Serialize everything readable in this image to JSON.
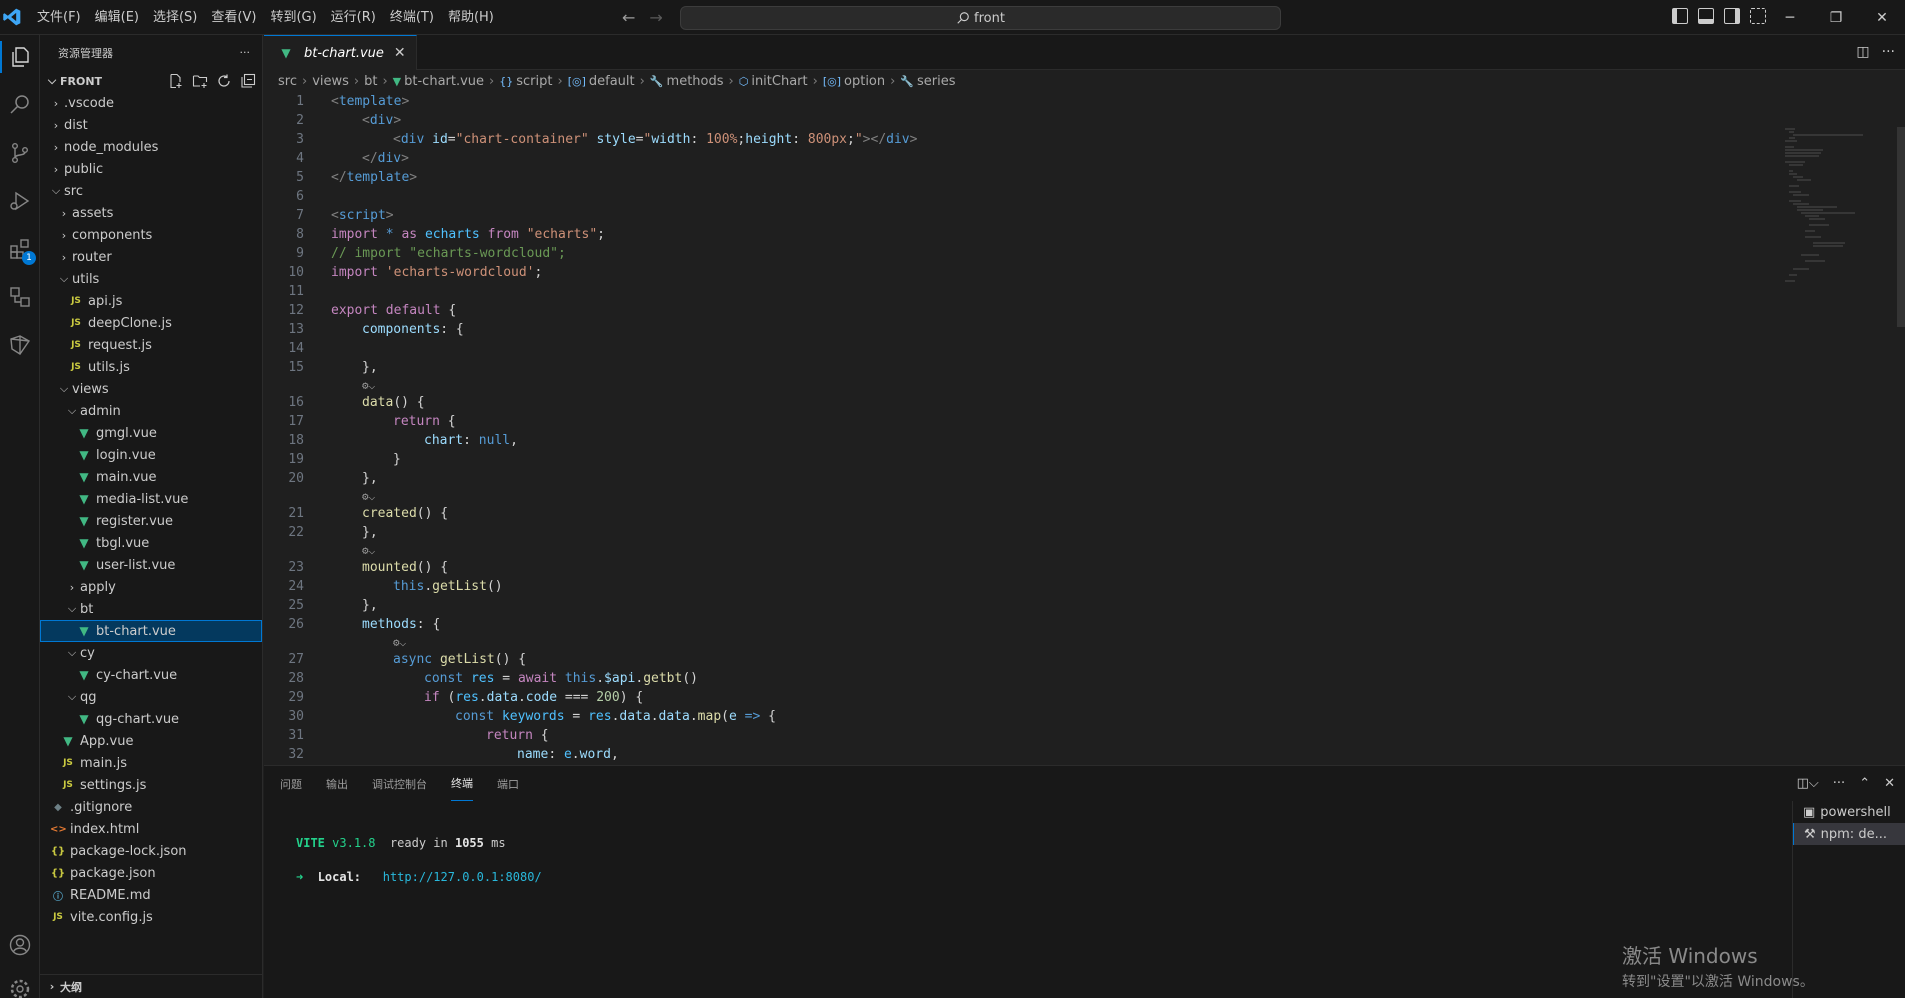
{
  "titlebar": {
    "menu": [
      "文件(F)",
      "编辑(E)",
      "选择(S)",
      "查看(V)",
      "转到(G)",
      "运行(R)",
      "终端(T)",
      "帮助(H)"
    ],
    "search_text": "front",
    "window_controls": [
      "─",
      "❐",
      "✕"
    ]
  },
  "activity": {
    "extensions_badge": "1"
  },
  "sidebar": {
    "title": "资源管理器",
    "more": "···",
    "folder": "FRONT",
    "tree": [
      {
        "label": ".vscode",
        "depth": 0,
        "type": "folder",
        "open": false
      },
      {
        "label": "dist",
        "depth": 0,
        "type": "folder",
        "open": false
      },
      {
        "label": "node_modules",
        "depth": 0,
        "type": "folder",
        "open": false
      },
      {
        "label": "public",
        "depth": 0,
        "type": "folder",
        "open": false
      },
      {
        "label": "src",
        "depth": 0,
        "type": "folder",
        "open": true
      },
      {
        "label": "assets",
        "depth": 1,
        "type": "folder",
        "open": false
      },
      {
        "label": "components",
        "depth": 1,
        "type": "folder",
        "open": false
      },
      {
        "label": "router",
        "depth": 1,
        "type": "folder",
        "open": false
      },
      {
        "label": "utils",
        "depth": 1,
        "type": "folder",
        "open": true
      },
      {
        "label": "api.js",
        "depth": 2,
        "type": "js"
      },
      {
        "label": "deepClone.js",
        "depth": 2,
        "type": "js"
      },
      {
        "label": "request.js",
        "depth": 2,
        "type": "js"
      },
      {
        "label": "utils.js",
        "depth": 2,
        "type": "js"
      },
      {
        "label": "views",
        "depth": 1,
        "type": "folder",
        "open": true
      },
      {
        "label": "admin",
        "depth": 2,
        "type": "folder",
        "open": true
      },
      {
        "label": "gmgl.vue",
        "depth": 3,
        "type": "vue"
      },
      {
        "label": "login.vue",
        "depth": 3,
        "type": "vue"
      },
      {
        "label": "main.vue",
        "depth": 3,
        "type": "vue"
      },
      {
        "label": "media-list.vue",
        "depth": 3,
        "type": "vue"
      },
      {
        "label": "register.vue",
        "depth": 3,
        "type": "vue"
      },
      {
        "label": "tbgl.vue",
        "depth": 3,
        "type": "vue"
      },
      {
        "label": "user-list.vue",
        "depth": 3,
        "type": "vue"
      },
      {
        "label": "apply",
        "depth": 2,
        "type": "folder",
        "open": false
      },
      {
        "label": "bt",
        "depth": 2,
        "type": "folder",
        "open": true
      },
      {
        "label": "bt-chart.vue",
        "depth": 3,
        "type": "vue",
        "selected": true
      },
      {
        "label": "cy",
        "depth": 2,
        "type": "folder",
        "open": true
      },
      {
        "label": "cy-chart.vue",
        "depth": 3,
        "type": "vue"
      },
      {
        "label": "qg",
        "depth": 2,
        "type": "folder",
        "open": true
      },
      {
        "label": "qg-chart.vue",
        "depth": 3,
        "type": "vue"
      },
      {
        "label": "App.vue",
        "depth": 1,
        "type": "vue"
      },
      {
        "label": "main.js",
        "depth": 1,
        "type": "js"
      },
      {
        "label": "settings.js",
        "depth": 1,
        "type": "js"
      },
      {
        "label": ".gitignore",
        "depth": 0,
        "type": "git"
      },
      {
        "label": "index.html",
        "depth": 0,
        "type": "html"
      },
      {
        "label": "package-lock.json",
        "depth": 0,
        "type": "json"
      },
      {
        "label": "package.json",
        "depth": 0,
        "type": "json"
      },
      {
        "label": "README.md",
        "depth": 0,
        "type": "info"
      },
      {
        "label": "vite.config.js",
        "depth": 0,
        "type": "js"
      }
    ],
    "outline": "大纲"
  },
  "editor": {
    "tab": "bt-chart.vue",
    "breadcrumb": [
      {
        "label": "src",
        "icon": ""
      },
      {
        "label": "views",
        "icon": ""
      },
      {
        "label": "bt",
        "icon": ""
      },
      {
        "label": "bt-chart.vue",
        "icon": "vue"
      },
      {
        "label": "script",
        "icon": "{}"
      },
      {
        "label": "default",
        "icon": "[◎]"
      },
      {
        "label": "methods",
        "icon": "🔧"
      },
      {
        "label": "initChart",
        "icon": "⬡"
      },
      {
        "label": "option",
        "icon": "[◎]"
      },
      {
        "label": "series",
        "icon": "🔧"
      }
    ],
    "lines": [
      {
        "n": "1",
        "ind": 0,
        "t": [
          [
            "tk-punc",
            "<"
          ],
          [
            "tk-tag",
            "template"
          ],
          [
            "tk-punc",
            ">"
          ]
        ]
      },
      {
        "n": "2",
        "ind": 1,
        "t": [
          [
            "tk-punc",
            "<"
          ],
          [
            "tk-tag",
            "div"
          ],
          [
            "tk-punc",
            ">"
          ]
        ]
      },
      {
        "n": "3",
        "ind": 2,
        "t": [
          [
            "tk-punc",
            "<"
          ],
          [
            "tk-tag",
            "div"
          ],
          [
            "tk-txt",
            " "
          ],
          [
            "tk-attr",
            "id"
          ],
          [
            "tk-txt",
            "="
          ],
          [
            "tk-str",
            "\"chart-container\""
          ],
          [
            "tk-txt",
            " "
          ],
          [
            "tk-attr",
            "style"
          ],
          [
            "tk-txt",
            "="
          ],
          [
            "tk-str",
            "\""
          ],
          [
            "tk-attr",
            "width"
          ],
          [
            "tk-txt",
            ": "
          ],
          [
            "tk-str",
            "100%"
          ],
          [
            "tk-txt",
            ";"
          ],
          [
            "tk-attr",
            "height"
          ],
          [
            "tk-txt",
            ": "
          ],
          [
            "tk-str",
            "800px"
          ],
          [
            "tk-txt",
            ";"
          ],
          [
            "tk-str",
            "\""
          ],
          [
            "tk-punc",
            "></"
          ],
          [
            "tk-tag",
            "div"
          ],
          [
            "tk-punc",
            ">"
          ]
        ]
      },
      {
        "n": "4",
        "ind": 1,
        "t": [
          [
            "tk-punc",
            "</"
          ],
          [
            "tk-tag",
            "div"
          ],
          [
            "tk-punc",
            ">"
          ]
        ]
      },
      {
        "n": "5",
        "ind": 0,
        "t": [
          [
            "tk-punc",
            "</"
          ],
          [
            "tk-tag",
            "template"
          ],
          [
            "tk-punc",
            ">"
          ]
        ]
      },
      {
        "n": "6",
        "ind": 0,
        "t": []
      },
      {
        "n": "7",
        "ind": 0,
        "t": [
          [
            "tk-punc",
            "<"
          ],
          [
            "tk-tag",
            "script"
          ],
          [
            "tk-punc",
            ">"
          ]
        ]
      },
      {
        "n": "8",
        "ind": 0,
        "t": [
          [
            "tk-kw",
            "import"
          ],
          [
            "tk-txt",
            " "
          ],
          [
            "tk-bl",
            "*"
          ],
          [
            "tk-txt",
            " "
          ],
          [
            "tk-kw",
            "as"
          ],
          [
            "tk-txt",
            " "
          ],
          [
            "tk-var",
            "echarts"
          ],
          [
            "tk-txt",
            " "
          ],
          [
            "tk-kw",
            "from"
          ],
          [
            "tk-txt",
            " "
          ],
          [
            "tk-str",
            "\"echarts\""
          ],
          [
            "tk-txt",
            ";"
          ]
        ]
      },
      {
        "n": "9",
        "ind": 0,
        "t": [
          [
            "tk-cm",
            "// import \"echarts-wordcloud\";"
          ]
        ]
      },
      {
        "n": "10",
        "ind": 0,
        "t": [
          [
            "tk-kw",
            "import"
          ],
          [
            "tk-txt",
            " "
          ],
          [
            "tk-str",
            "'echarts-wordcloud'"
          ],
          [
            "tk-txt",
            ";"
          ]
        ]
      },
      {
        "n": "11",
        "ind": 0,
        "t": []
      },
      {
        "n": "12",
        "ind": 0,
        "t": [
          [
            "tk-kw",
            "export"
          ],
          [
            "tk-txt",
            " "
          ],
          [
            "tk-kw",
            "default"
          ],
          [
            "tk-txt",
            " {"
          ]
        ]
      },
      {
        "n": "13",
        "ind": 1,
        "t": [
          [
            "tk-prop",
            "components"
          ],
          [
            "tk-txt",
            ": {"
          ]
        ]
      },
      {
        "n": "14",
        "ind": 0,
        "t": []
      },
      {
        "n": "15",
        "ind": 1,
        "t": [
          [
            "tk-txt",
            "},"
          ]
        ]
      },
      {
        "lens": true,
        "ind": 1
      },
      {
        "n": "16",
        "ind": 1,
        "t": [
          [
            "tk-fn",
            "data"
          ],
          [
            "tk-txt",
            "() {"
          ]
        ]
      },
      {
        "n": "17",
        "ind": 2,
        "t": [
          [
            "tk-kw",
            "return"
          ],
          [
            "tk-txt",
            " {"
          ]
        ]
      },
      {
        "n": "18",
        "ind": 3,
        "t": [
          [
            "tk-prop",
            "chart"
          ],
          [
            "tk-txt",
            ": "
          ],
          [
            "tk-bl",
            "null"
          ],
          [
            "tk-txt",
            ","
          ]
        ]
      },
      {
        "n": "19",
        "ind": 2,
        "t": [
          [
            "tk-txt",
            "}"
          ]
        ]
      },
      {
        "n": "20",
        "ind": 1,
        "t": [
          [
            "tk-txt",
            "},"
          ]
        ]
      },
      {
        "lens": true,
        "ind": 1
      },
      {
        "n": "21",
        "ind": 1,
        "t": [
          [
            "tk-fn",
            "created"
          ],
          [
            "tk-txt",
            "() {"
          ]
        ]
      },
      {
        "n": "22",
        "ind": 1,
        "t": [
          [
            "tk-txt",
            "},"
          ]
        ]
      },
      {
        "lens": true,
        "ind": 1
      },
      {
        "n": "23",
        "ind": 1,
        "t": [
          [
            "tk-fn",
            "mounted"
          ],
          [
            "tk-txt",
            "() {"
          ]
        ]
      },
      {
        "n": "24",
        "ind": 2,
        "t": [
          [
            "tk-bl",
            "this"
          ],
          [
            "tk-txt",
            "."
          ],
          [
            "tk-fn",
            "getList"
          ],
          [
            "tk-txt",
            "()"
          ]
        ]
      },
      {
        "n": "25",
        "ind": 1,
        "t": [
          [
            "tk-txt",
            "},"
          ]
        ]
      },
      {
        "n": "26",
        "ind": 1,
        "t": [
          [
            "tk-prop",
            "methods"
          ],
          [
            "tk-txt",
            ": {"
          ]
        ]
      },
      {
        "lens": true,
        "ind": 2
      },
      {
        "n": "27",
        "ind": 2,
        "t": [
          [
            "tk-bl",
            "async"
          ],
          [
            "tk-txt",
            " "
          ],
          [
            "tk-fn",
            "getList"
          ],
          [
            "tk-txt",
            "() {"
          ]
        ]
      },
      {
        "n": "28",
        "ind": 3,
        "t": [
          [
            "tk-bl",
            "const"
          ],
          [
            "tk-txt",
            " "
          ],
          [
            "tk-var",
            "res"
          ],
          [
            "tk-txt",
            " = "
          ],
          [
            "tk-kw",
            "await"
          ],
          [
            "tk-txt",
            " "
          ],
          [
            "tk-bl",
            "this"
          ],
          [
            "tk-txt",
            "."
          ],
          [
            "tk-prop",
            "$api"
          ],
          [
            "tk-txt",
            "."
          ],
          [
            "tk-fn",
            "getbt"
          ],
          [
            "tk-txt",
            "()"
          ]
        ]
      },
      {
        "n": "29",
        "ind": 3,
        "t": [
          [
            "tk-kw",
            "if"
          ],
          [
            "tk-txt",
            " ("
          ],
          [
            "tk-var",
            "res"
          ],
          [
            "tk-txt",
            "."
          ],
          [
            "tk-prop",
            "data"
          ],
          [
            "tk-txt",
            "."
          ],
          [
            "tk-prop",
            "code"
          ],
          [
            "tk-txt",
            " === "
          ],
          [
            "tk-num",
            "200"
          ],
          [
            "tk-txt",
            ") {"
          ]
        ]
      },
      {
        "n": "30",
        "ind": 4,
        "t": [
          [
            "tk-bl",
            "const"
          ],
          [
            "tk-txt",
            " "
          ],
          [
            "tk-var",
            "keywords"
          ],
          [
            "tk-txt",
            " = "
          ],
          [
            "tk-var",
            "res"
          ],
          [
            "tk-txt",
            "."
          ],
          [
            "tk-prop",
            "data"
          ],
          [
            "tk-txt",
            "."
          ],
          [
            "tk-prop",
            "data"
          ],
          [
            "tk-txt",
            "."
          ],
          [
            "tk-fn",
            "map"
          ],
          [
            "tk-txt",
            "("
          ],
          [
            "tk-prop",
            "e"
          ],
          [
            "tk-txt",
            " "
          ],
          [
            "tk-bl",
            "=>"
          ],
          [
            "tk-txt",
            " {"
          ]
        ]
      },
      {
        "n": "31",
        "ind": 5,
        "t": [
          [
            "tk-kw",
            "return"
          ],
          [
            "tk-txt",
            " {"
          ]
        ]
      },
      {
        "n": "32",
        "ind": 6,
        "t": [
          [
            "tk-prop",
            "name"
          ],
          [
            "tk-txt",
            ": "
          ],
          [
            "tk-var",
            "e"
          ],
          [
            "tk-txt",
            "."
          ],
          [
            "tk-prop",
            "word"
          ],
          [
            "tk-txt",
            ","
          ]
        ]
      }
    ]
  },
  "panel": {
    "tabs": [
      "问题",
      "输出",
      "调试控制台",
      "终端",
      "端口"
    ],
    "active_tab": "终端",
    "terminal": {
      "vite": "VITE",
      "version": "v3.1.8",
      "ready": "ready in",
      "ms_value": "1055",
      "ms": "ms",
      "arrow": "➜",
      "local_label": "Local:",
      "url": "http://127.0.0.1:8080/"
    },
    "terminals": [
      "powershell",
      "npm: de..."
    ]
  },
  "watermark": {
    "line1": "激活 Windows",
    "line2": "转到\"设置\"以激活 Windows。"
  }
}
